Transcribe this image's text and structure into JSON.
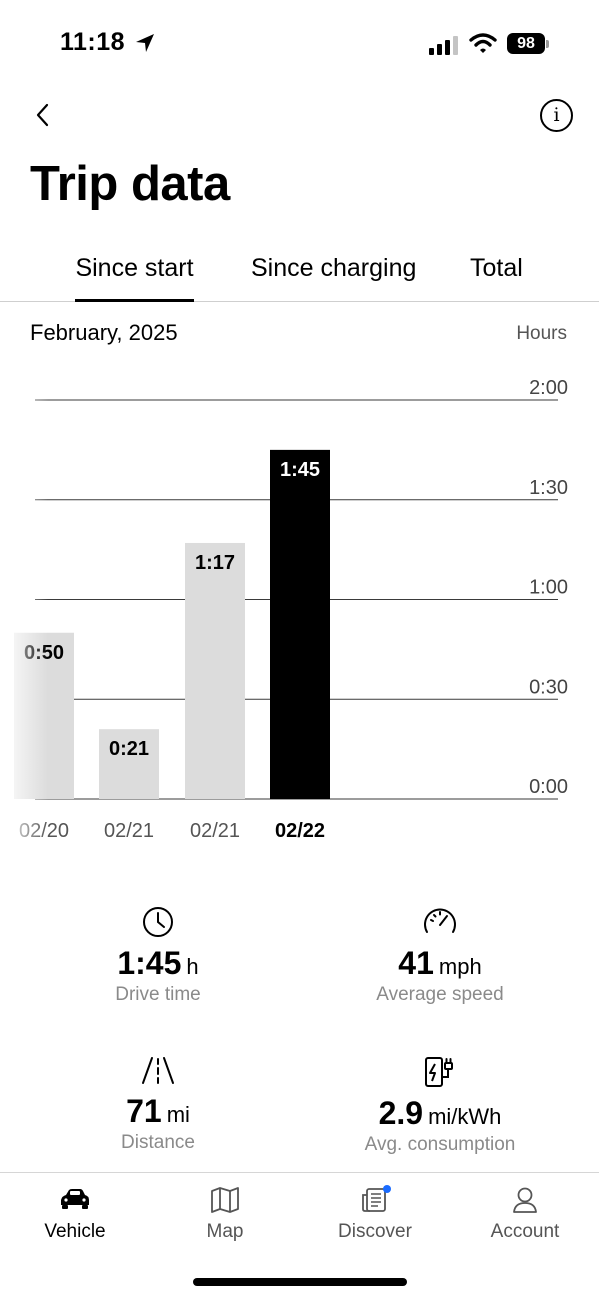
{
  "status_bar": {
    "time": "11:18",
    "battery": "98"
  },
  "header": {
    "title": "Trip data"
  },
  "tabs": [
    {
      "label": "Since start",
      "active": true
    },
    {
      "label": "Since charging",
      "active": false
    },
    {
      "label": "Total",
      "active": false
    }
  ],
  "period_label": "February, 2025",
  "unit_label": "Hours",
  "chart_data": {
    "type": "bar",
    "categories": [
      "02/20",
      "02/21",
      "02/21",
      "02/22"
    ],
    "values": [
      0.8333,
      0.35,
      1.2833,
      1.75
    ],
    "value_labels": [
      "0:50",
      "0:21",
      "1:17",
      "1:45"
    ],
    "selected_index": 3,
    "y_tick_labels": [
      "0:00",
      "0:30",
      "1:00",
      "1:30",
      "2:00"
    ],
    "y_ticks": [
      0,
      0.5,
      1,
      1.5,
      2
    ],
    "ylim": [
      0,
      2.0833
    ],
    "grid": true,
    "colors": {
      "bar": "#dcdcdc",
      "selected_bar": "#000000",
      "grid": "#3a3a3a"
    }
  },
  "stats": {
    "drive_time": {
      "value": "1:45",
      "unit": "h",
      "label": "Drive time",
      "icon": "clock-icon"
    },
    "avg_speed": {
      "value": "41",
      "unit": "mph",
      "label": "Average speed",
      "icon": "speedometer-icon"
    },
    "distance": {
      "value": "71",
      "unit": "mi",
      "label": "Distance",
      "icon": "road-icon"
    },
    "consumption": {
      "value": "2.9",
      "unit": "mi/kWh",
      "label": "Avg. consumption",
      "icon": "charging-icon"
    }
  },
  "nav": [
    {
      "label": "Vehicle",
      "icon": "car-icon",
      "active": true
    },
    {
      "label": "Map",
      "icon": "map-icon",
      "active": false
    },
    {
      "label": "Discover",
      "icon": "discover-icon",
      "active": false,
      "badge_color": "#1a6bff"
    },
    {
      "label": "Account",
      "icon": "account-icon",
      "active": false
    }
  ]
}
